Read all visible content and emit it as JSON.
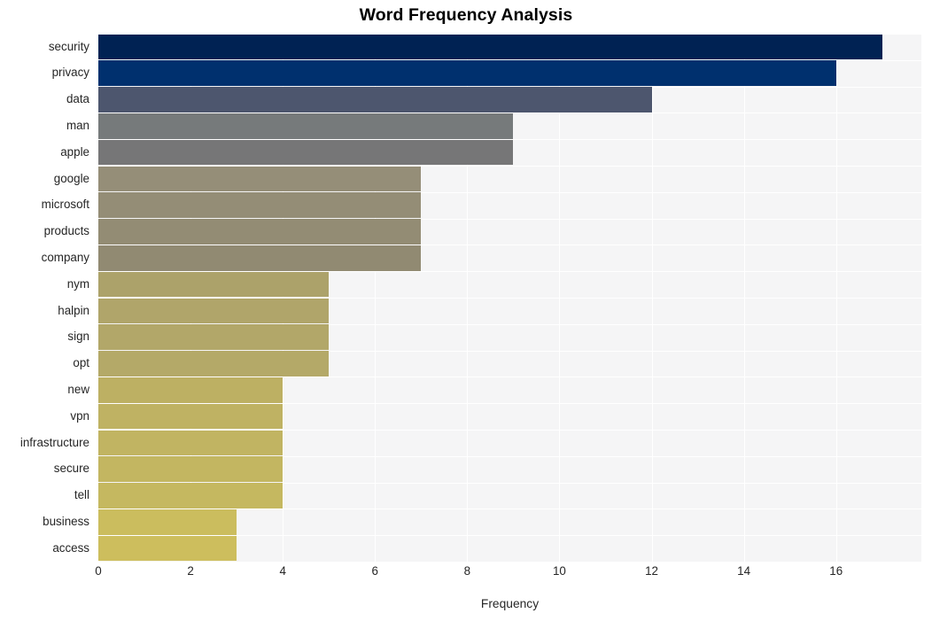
{
  "chart_data": {
    "type": "bar",
    "orientation": "horizontal",
    "title": "Word Frequency Analysis",
    "xlabel": "Frequency",
    "ylabel": "",
    "xlim": [
      0,
      17.85
    ],
    "xticks": [
      0,
      2,
      4,
      6,
      8,
      10,
      12,
      14,
      16
    ],
    "grid": true,
    "legend": null,
    "categories": [
      "security",
      "privacy",
      "data",
      "man",
      "apple",
      "google",
      "microsoft",
      "products",
      "company",
      "nym",
      "halpin",
      "sign",
      "opt",
      "new",
      "vpn",
      "infrastructure",
      "secure",
      "tell",
      "business",
      "access"
    ],
    "values": [
      17,
      16,
      12,
      9,
      9,
      7,
      7,
      7,
      7,
      5,
      5,
      5,
      5,
      4,
      4,
      4,
      4,
      4,
      3,
      3
    ],
    "bar_colors": [
      "#002253",
      "#00306e",
      "#4d566e",
      "#767a7b",
      "#767677",
      "#958e78",
      "#948d76",
      "#938c74",
      "#918a72",
      "#aca26a",
      "#b0a56a",
      "#b2a769",
      "#b4a968",
      "#bdb063",
      "#bfb263",
      "#c1b462",
      "#c3b661",
      "#c5b860",
      "#cbbd5e",
      "#cdbe5d"
    ]
  },
  "axis": {
    "xlabel": "Frequency"
  }
}
